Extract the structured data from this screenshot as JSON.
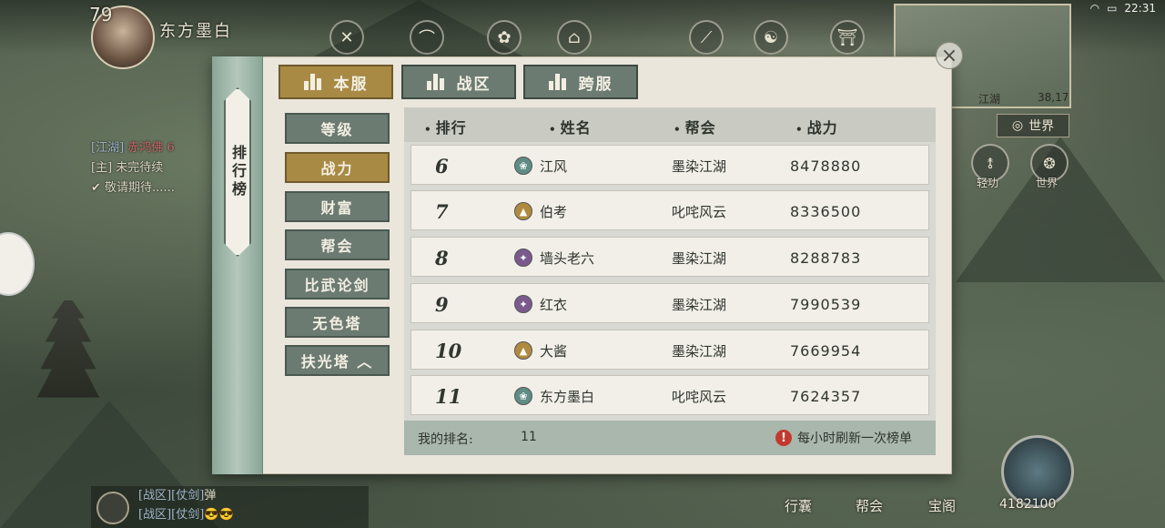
{
  "hud": {
    "level": "79",
    "player_name": "东方墨白",
    "time": "22:31",
    "minimap_label": "江湖",
    "minimap_coords": "38,17",
    "world_button": "世界",
    "power_total": "4182100",
    "side_buttons": [
      {
        "label": "轻功",
        "icon": "feather-icon"
      },
      {
        "label": "世界",
        "icon": "globe-icon"
      }
    ],
    "bottom_nav": [
      "行囊",
      "帮会",
      "宝阁"
    ]
  },
  "chat": {
    "lines": [
      {
        "channel": "[江湖]",
        "text": "赤鸿佛 6"
      },
      {
        "channel": "[主]",
        "text": "未完待续"
      },
      {
        "channel": "",
        "text": "敬请期待......"
      }
    ],
    "bottom_lines": [
      {
        "tag": "[战区]",
        "tag2": "[仗剑]",
        "text": "弹"
      },
      {
        "tag": "[战区]",
        "tag2": "[仗剑]",
        "text": "😎😎"
      }
    ]
  },
  "panel": {
    "side_title": "排行榜",
    "tabs": [
      {
        "label": "本服",
        "active": true
      },
      {
        "label": "战区",
        "active": false
      },
      {
        "label": "跨服",
        "active": false
      }
    ],
    "categories": [
      {
        "label": "等级",
        "active": false
      },
      {
        "label": "战力",
        "active": true
      },
      {
        "label": "财富",
        "active": false
      },
      {
        "label": "帮会",
        "active": false
      },
      {
        "label": "比武论剑",
        "active": false
      },
      {
        "label": "无色塔",
        "active": false
      },
      {
        "label": "扶光塔 ︿",
        "active": false
      }
    ],
    "columns": [
      "排行",
      "姓名",
      "帮会",
      "战力"
    ],
    "rows": [
      {
        "rank": "6",
        "name": "江风",
        "guild": "墨染江湖",
        "power": "8478880",
        "emblem_color": "#5f8c84"
      },
      {
        "rank": "7",
        "name": "伯考",
        "guild": "叱咤风云",
        "power": "8336500",
        "emblem_color": "#b08a3e"
      },
      {
        "rank": "8",
        "name": "墙头老六",
        "guild": "墨染江湖",
        "power": "8288783",
        "emblem_color": "#7a5a8c"
      },
      {
        "rank": "9",
        "name": "红衣",
        "guild": "墨染江湖",
        "power": "7990539",
        "emblem_color": "#7a5a8c"
      },
      {
        "rank": "10",
        "name": "大酱",
        "guild": "墨染江湖",
        "power": "7669954",
        "emblem_color": "#b08a3e"
      },
      {
        "rank": "11",
        "name": "东方墨白",
        "guild": "叱咤风云",
        "power": "7624357",
        "emblem_color": "#5f8c84"
      }
    ],
    "my_rank_label": "我的排名:",
    "my_rank_value": "11",
    "refresh_note": "每小时刷新一次榜单"
  }
}
